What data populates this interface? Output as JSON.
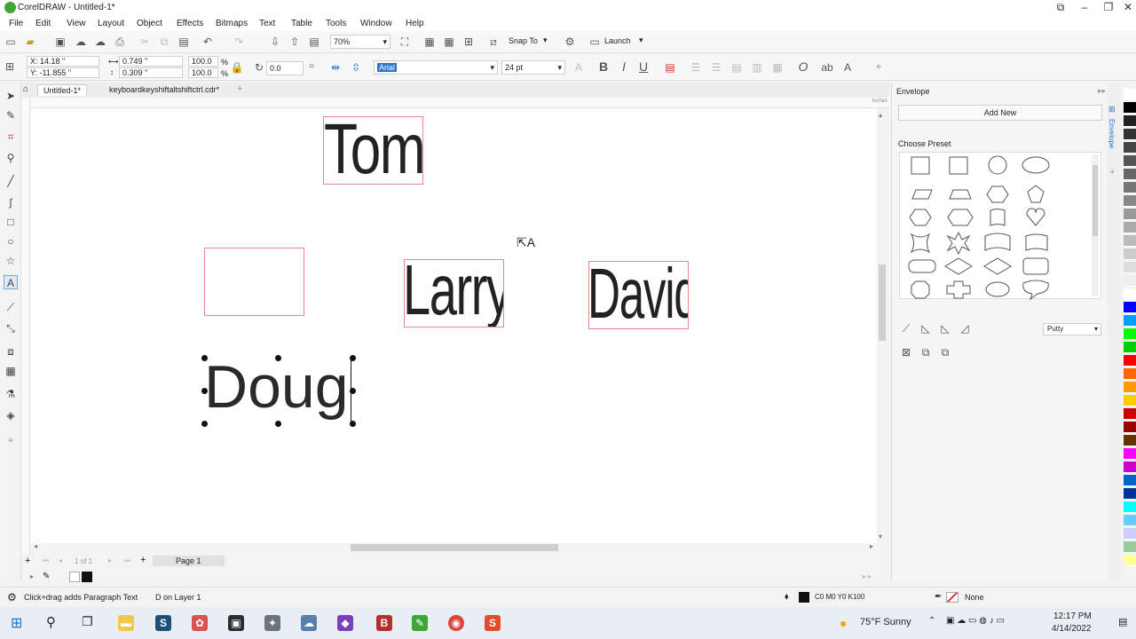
{
  "window": {
    "title": "CorelDRAW - Untitled-1*"
  },
  "menu": [
    "File",
    "Edit",
    "View",
    "Layout",
    "Object",
    "Effects",
    "Bitmaps",
    "Text",
    "Table",
    "Tools",
    "Window",
    "Help"
  ],
  "toolbar": {
    "zoom": "70%",
    "snap_label": "Snap To",
    "launch_label": "Launch"
  },
  "propbar": {
    "x": "X: 14.18 \"",
    "y": "Y: -11.855 \"",
    "w": "0.749 \"",
    "h": "0.309 \"",
    "scale_w": "100.0",
    "scale_h": "100.0",
    "pct": "%",
    "angle": "0.0",
    "font": "Arial",
    "size": "24 pt",
    "bold": "B",
    "italic": "I",
    "underline": "U"
  },
  "tabs": [
    "Untitled-1*",
    "keyboardkeyshiftaltshiftctrl.cdr*"
  ],
  "ruler": {
    "units": "inches"
  },
  "canvas": {
    "items": [
      "Tom",
      "Larry",
      "David",
      "Doug"
    ]
  },
  "pagenav": {
    "page_of": "1 of 1",
    "page_tab": "Page 1"
  },
  "docker": {
    "title": "Envelope",
    "add_new": "Add New",
    "choose_preset": "Choose Preset",
    "mode": "Putty",
    "vtab": "Envelope"
  },
  "status": {
    "hint": "Click+drag adds Paragraph Text",
    "layer": "D on Layer 1",
    "fill": "C0 M0 Y0 K100",
    "outline": "None"
  },
  "taskbar": {
    "weather": "75°F  Sunny",
    "time": "12:17 PM",
    "date": "4/14/2022"
  },
  "colors": {
    "accent": "#3fa535",
    "selection": "#e58a8a",
    "palette": [
      "#ffffff",
      "#000000",
      "#222222",
      "#333333",
      "#444444",
      "#555555",
      "#666666",
      "#777777",
      "#888888",
      "#999999",
      "#aaaaaa",
      "#bbbbbb",
      "#cccccc",
      "#dddddd",
      "#eeeeee",
      "#ffffff",
      "#0000ff",
      "#00a0ff",
      "#00ff00",
      "#00cc00",
      "#ff0000",
      "#ff6600",
      "#ff9900",
      "#ffcc00",
      "#cc0000",
      "#990000",
      "#663300",
      "#ff00ff",
      "#cc00cc",
      "#0066cc",
      "#003399",
      "#00ffff",
      "#66ccff",
      "#ccccff",
      "#99cc99",
      "#ffff99"
    ]
  }
}
